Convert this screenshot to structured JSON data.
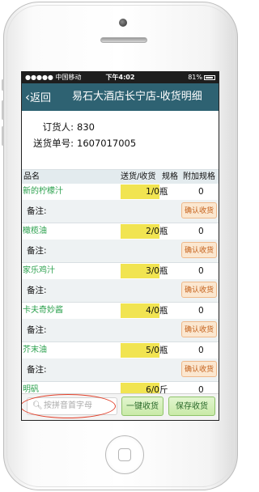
{
  "status_bar": {
    "carrier": "●●●●● 中国移动",
    "time": "下午4:02",
    "battery": "81%"
  },
  "nav": {
    "back_label": "返回",
    "title": "易石大酒店长宁店-收货明细"
  },
  "order": {
    "buyer_label": "订货人:",
    "buyer_value": "830",
    "number_label": "送货单号:",
    "number_value": "1607017005"
  },
  "table": {
    "headers": {
      "name": "品名",
      "qty": "送货/收货",
      "unit": "规格",
      "extra": "附加规格"
    },
    "note_label": "备注:",
    "confirm_label": "确认收货",
    "items": [
      {
        "name": "新的柠檬汁",
        "qty": "1/0",
        "unit": "瓶",
        "extra": "0"
      },
      {
        "name": "橄榄油",
        "qty": "2/0",
        "unit": "瓶",
        "extra": "0"
      },
      {
        "name": "家乐鸡汁",
        "qty": "3/0",
        "unit": "瓶",
        "extra": "0"
      },
      {
        "name": "卡夫奇妙酱",
        "qty": "4/0",
        "unit": "瓶",
        "extra": "0"
      },
      {
        "name": "芥末油",
        "qty": "5/0",
        "unit": "瓶",
        "extra": "0"
      },
      {
        "name": "明矾",
        "qty": "6/0",
        "unit": "斤",
        "extra": "0"
      }
    ]
  },
  "bottom": {
    "search_placeholder": "按拼音首字母",
    "one_click_label": "一键收货",
    "save_label": "保存收货"
  },
  "colors": {
    "nav_bg": "#2e6272",
    "item_name": "#2aa04c",
    "qty_highlight": "#f1e451",
    "annotation_oval": "#e2402a"
  }
}
